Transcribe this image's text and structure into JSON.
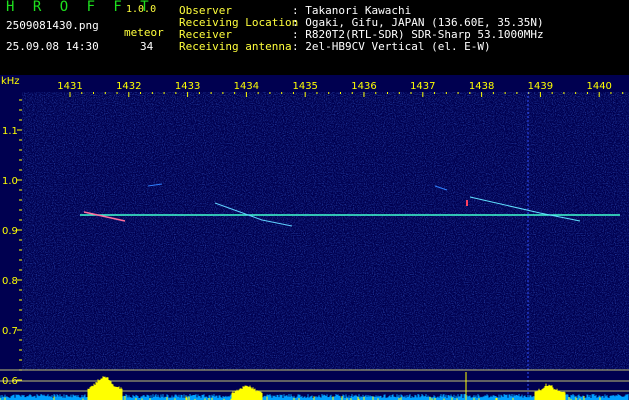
{
  "header": {
    "app_title": "H R O F F T",
    "app_version": "1.0.0",
    "filename": "2509081430.png",
    "timestamp": "25.09.08 14:30",
    "meteor_label": "meteor",
    "meteor_count": "34"
  },
  "info": [
    {
      "key": "Observer",
      "value": ": Takanori Kawachi"
    },
    {
      "key": "Receiving Location",
      "value": ": Ogaki, Gifu, JAPAN (136.60E, 35.35N)"
    },
    {
      "key": "Receiver",
      "value": ": R820T2(RTL-SDR) SDR-Sharp 53.1000MHz"
    },
    {
      "key": "Receiving antenna",
      "value": ": 2el-HB9CV Vertical (el. E-W)"
    }
  ],
  "spectrogram": {
    "y_unit": "kHz",
    "x_ticks": [
      "1431",
      "1432",
      "1433",
      "1434",
      "1435",
      "1436",
      "1437",
      "1438",
      "1439",
      "1440"
    ],
    "y_ticks": [
      "1.1",
      "1.0",
      "0.9",
      "0.8",
      "0.7",
      "0.6"
    ],
    "colors": {
      "background": "#000060",
      "axis_text": "#ffff00",
      "carrier": "#40ffd0",
      "power": "#ffff00",
      "noise": "#00a0ff"
    }
  }
}
